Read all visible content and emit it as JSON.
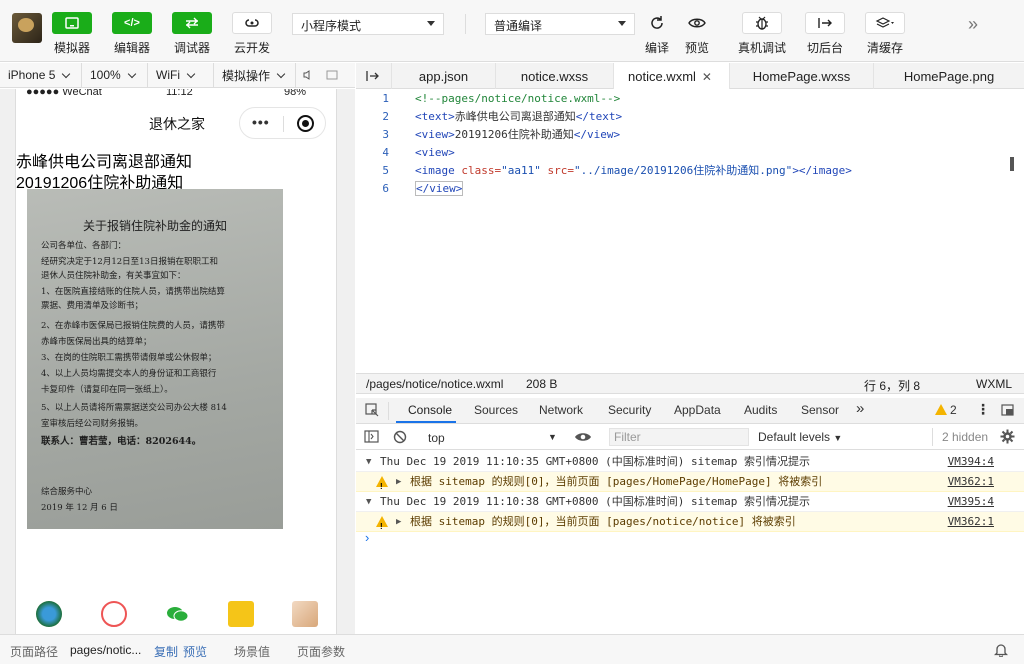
{
  "toolbar": {
    "buttons": [
      {
        "label": "模拟器",
        "glyph": "▭"
      },
      {
        "label": "编辑器",
        "glyph": "</>"
      },
      {
        "label": "调试器",
        "glyph": "⇆"
      },
      {
        "label": "云开发",
        "glyph": "☁"
      }
    ],
    "mode_select": "小程序模式",
    "compile_select": "普通编译",
    "actions": [
      {
        "label": "编译"
      },
      {
        "label": "预览"
      },
      {
        "label": "真机调试"
      },
      {
        "label": "切后台"
      },
      {
        "label": "清缓存"
      }
    ]
  },
  "device_bar": {
    "device": "iPhone 5",
    "zoom": "100%",
    "network": "WiFi",
    "operation": "模拟操作"
  },
  "phone": {
    "status_carrier": "●●●●● WeChat",
    "status_time": "11:12",
    "status_battery": "98%",
    "nav_title": "退休之家",
    "capsule_dots": "•••",
    "text_line1": "赤峰供电公司离退部通知",
    "text_line2": "20191206住院补助通知",
    "notice": {
      "title": "关于报销住院补助金的通知",
      "lines": [
        "公司各单位、各部门：",
        "    经研究决定于12月12日至13日报销在职职工和",
        "退休人员住院补助金，有关事宜如下：",
        "    1、在医院直接结账的住院人员，请携带出院结算",
        "票据、费用清单及诊断书；",
        "    2、在赤峰市医保局已报销住院费的人员，请携带",
        "赤峰市医保局出具的结算单；",
        "    3、在岗的住院职工需携带请假单或公休假单；",
        "    4、以上人员均需提交本人的身份证和工商银行",
        "卡复印件（请复印在同一张纸上）。",
        "    5、以上人员请将所需票据送交公司办公大楼 814",
        "室审核后经公司财务报销。",
        "        联系人：曹若莹，电话：8202644。",
        "                                综合服务中心",
        "                            2019 年 12 月 6 日"
      ]
    }
  },
  "bottom_bar": {
    "path_label": "页面路径",
    "path_value": "pages/notic...",
    "copy": "复制",
    "preview": "预览",
    "scene": "场景值",
    "params": "页面参数"
  },
  "editor": {
    "tabs": [
      "app.json",
      "notice.wxss",
      "notice.wxml",
      "HomePage.wxss",
      "HomePage.png"
    ],
    "active_tab": "notice.wxml",
    "close_glyph": "✕",
    "line_numbers": [
      "1",
      "2",
      "3",
      "4",
      "5",
      "6"
    ],
    "code": {
      "l1": "<!--pages/notice/notice.wxml-->",
      "l2_open": "<text>",
      "l2_text": "赤峰供电公司离退部通知",
      "l2_close": "</text>",
      "l3_open": "<view>",
      "l3_text": "20191206住院补助通知",
      "l3_close": "</view>",
      "l4": "<view>",
      "l5_tag": "<image",
      "l5_attr1": " class=",
      "l5_val1": "\"aa11\"",
      "l5_attr2": " src=",
      "l5_val2": "\"../image/20191206住院补助通知.png\"",
      "l5_end": "></image>",
      "l6": "</view>"
    },
    "status": {
      "path": "/pages/notice/notice.wxml",
      "size": "208 B",
      "position": "行 6，列 8",
      "lang": "WXML"
    }
  },
  "devtools": {
    "tabs": [
      "Console",
      "Sources",
      "Network",
      "Security",
      "AppData",
      "Audits",
      "Sensor"
    ],
    "more": "»",
    "warn_count": "2",
    "context": "top",
    "filter_placeholder": "Filter",
    "levels": "Default levels",
    "hidden": "2 hidden",
    "messages": [
      {
        "type": "group",
        "text": "Thu Dec 19 2019 11:10:35 GMT+0800 (中国标准时间) sitemap 索引情况提示",
        "src": "VM394:4"
      },
      {
        "type": "warn",
        "text": "根据 sitemap 的规则[0]，当前页面 [pages/HomePage/HomePage] 将被索引",
        "src": "VM362:1"
      },
      {
        "type": "group",
        "text": "Thu Dec 19 2019 11:10:38 GMT+0800 (中国标准时间) sitemap 索引情况提示",
        "src": "VM395:4"
      },
      {
        "type": "warn",
        "text": "根据 sitemap 的规则[0]，当前页面 [pages/notice/notice] 将被索引",
        "src": "VM362:1"
      }
    ],
    "prompt": "›"
  }
}
